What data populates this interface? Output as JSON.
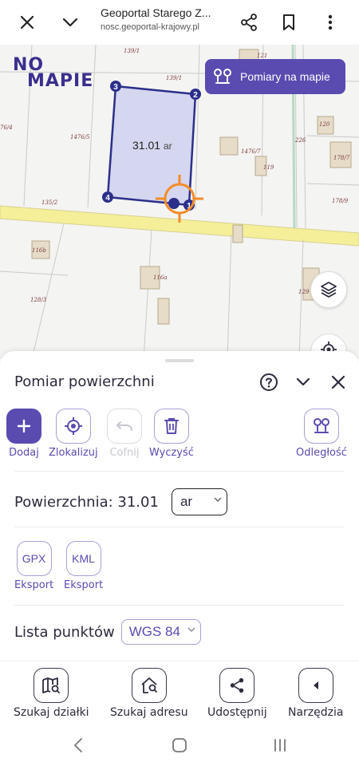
{
  "browser": {
    "page_title": "Geoportal Starego Z...",
    "url": "nosc.geoportal-krajowy.pl"
  },
  "map": {
    "logo_line1": "NO",
    "logo_line2": "MAPIE",
    "measure_button": "Pomiary na mapie",
    "area_value": "31.01",
    "area_unit": "ar",
    "parcel_labels": [
      "139/1",
      "139/1",
      "121",
      "1476/5",
      "226",
      "120",
      "1476/7",
      "119",
      "178/7",
      "135/2",
      "178/9",
      "116b",
      "116a",
      "128/3",
      "129",
      "76/4"
    ],
    "vertex_labels": [
      "1",
      "2",
      "3",
      "4"
    ]
  },
  "panel": {
    "title": "Pomiar powierzchni",
    "tools": [
      {
        "label": "Dodaj"
      },
      {
        "label": "Zlokalizuj"
      },
      {
        "label": "Cofnij"
      },
      {
        "label": "Wyczyść"
      },
      {
        "label": "Odległość"
      }
    ],
    "area_text": "Powierzchnia: 31.01",
    "unit_selected": "ar",
    "export": [
      {
        "format": "GPX",
        "label": "Eksport"
      },
      {
        "format": "KML",
        "label": "Eksport"
      }
    ],
    "points_label": "Lista punktów",
    "crs_selected": "WGS 84"
  },
  "bottom_nav": [
    {
      "label": "Szukaj działki"
    },
    {
      "label": "Szukaj adresu"
    },
    {
      "label": "Udostępnij"
    },
    {
      "label": "Narzędzia"
    }
  ],
  "colors": {
    "accent": "#5a4bb0",
    "polygon_fill": "#cfd0ee",
    "polygon_stroke": "#2b2f8a",
    "crosshair": "#f28c28",
    "road": "#f5ef9a"
  }
}
